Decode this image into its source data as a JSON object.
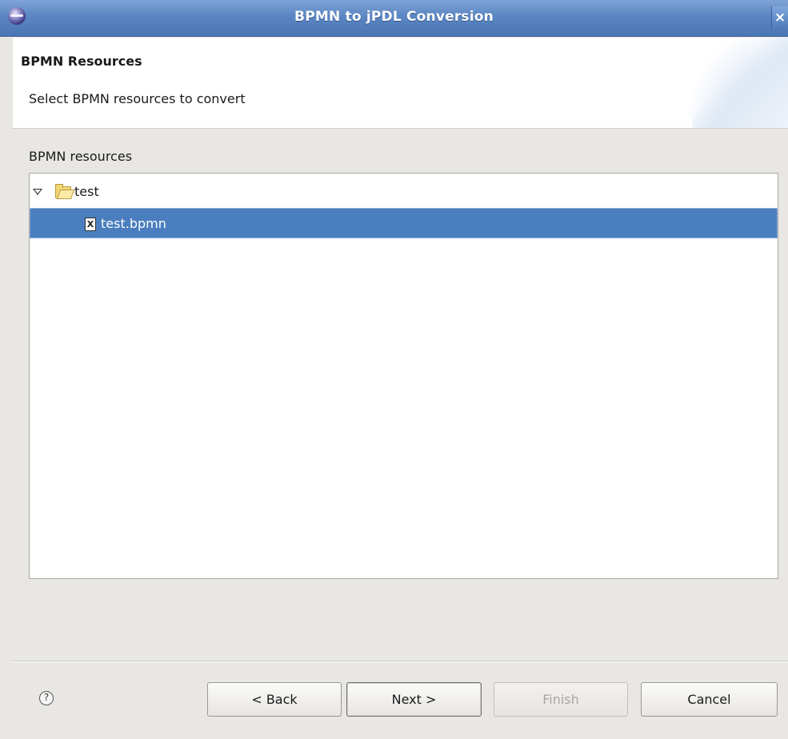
{
  "window": {
    "title": "BPMN to jPDL Conversion",
    "close_label": "×"
  },
  "banner": {
    "title": "BPMN Resources",
    "description": "Select BPMN resources to convert"
  },
  "resources": {
    "label": "BPMN resources",
    "tree": [
      {
        "label": "test",
        "icon": "folder-open-icon",
        "expanded": true,
        "selected": false
      },
      {
        "label": "test.bpmn",
        "icon": "xml-file-icon",
        "selected": true
      }
    ]
  },
  "footer": {
    "help_label": "?",
    "back_label": "< Back",
    "next_label": "Next >",
    "finish_label": "Finish",
    "cancel_label": "Cancel",
    "finish_enabled": false
  },
  "colors": {
    "titlebar": "#5b86c3",
    "selection": "#4a7ebf",
    "dialog_bg": "#e9e7e3"
  }
}
